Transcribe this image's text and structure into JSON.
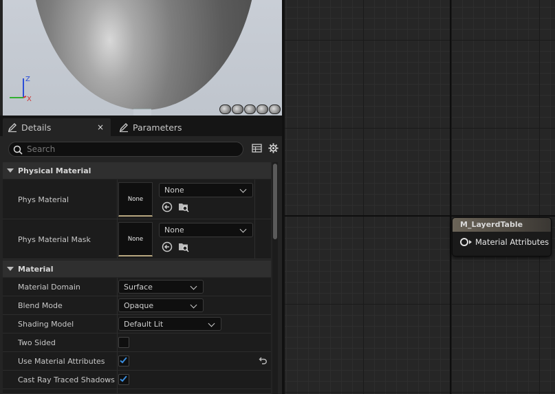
{
  "viewport": {
    "axis": {
      "z": "Z",
      "x": "X"
    }
  },
  "tabs": {
    "details": "Details",
    "close": "×",
    "parameters": "Parameters"
  },
  "search": {
    "placeholder": "Search"
  },
  "categories": {
    "physical": "Physical Material",
    "material": "Material"
  },
  "physical_material": {
    "phys_material": {
      "label": "Phys Material",
      "thumb": "None",
      "value": "None"
    },
    "phys_material_mask": {
      "label": "Phys Material Mask",
      "thumb": "None",
      "value": "None"
    }
  },
  "material": {
    "domain": {
      "label": "Material Domain",
      "value": "Surface"
    },
    "blend_mode": {
      "label": "Blend Mode",
      "value": "Opaque"
    },
    "shading_model": {
      "label": "Shading Model",
      "value": "Default Lit"
    },
    "two_sided": {
      "label": "Two Sided",
      "checked": false
    },
    "use_material_attributes": {
      "label": "Use Material Attributes",
      "checked": true
    },
    "cast_ray_traced_shadows": {
      "label": "Cast Ray Traced Shadows",
      "checked": true
    }
  },
  "node": {
    "title": "M_LayerdTable",
    "pin_label": "Material Attributes"
  },
  "colors": {
    "accent_check": "#3b8fe0",
    "node_header": "#6b6458",
    "thumb_underline": "#b8a780"
  },
  "icons": [
    "details-pen-icon",
    "parameters-pen-icon",
    "search-icon",
    "table-view-icon",
    "settings-gear-icon",
    "use-selected-arrow-icon",
    "browse-folder-icon",
    "reset-to-default-icon",
    "chevron-down-icon"
  ]
}
